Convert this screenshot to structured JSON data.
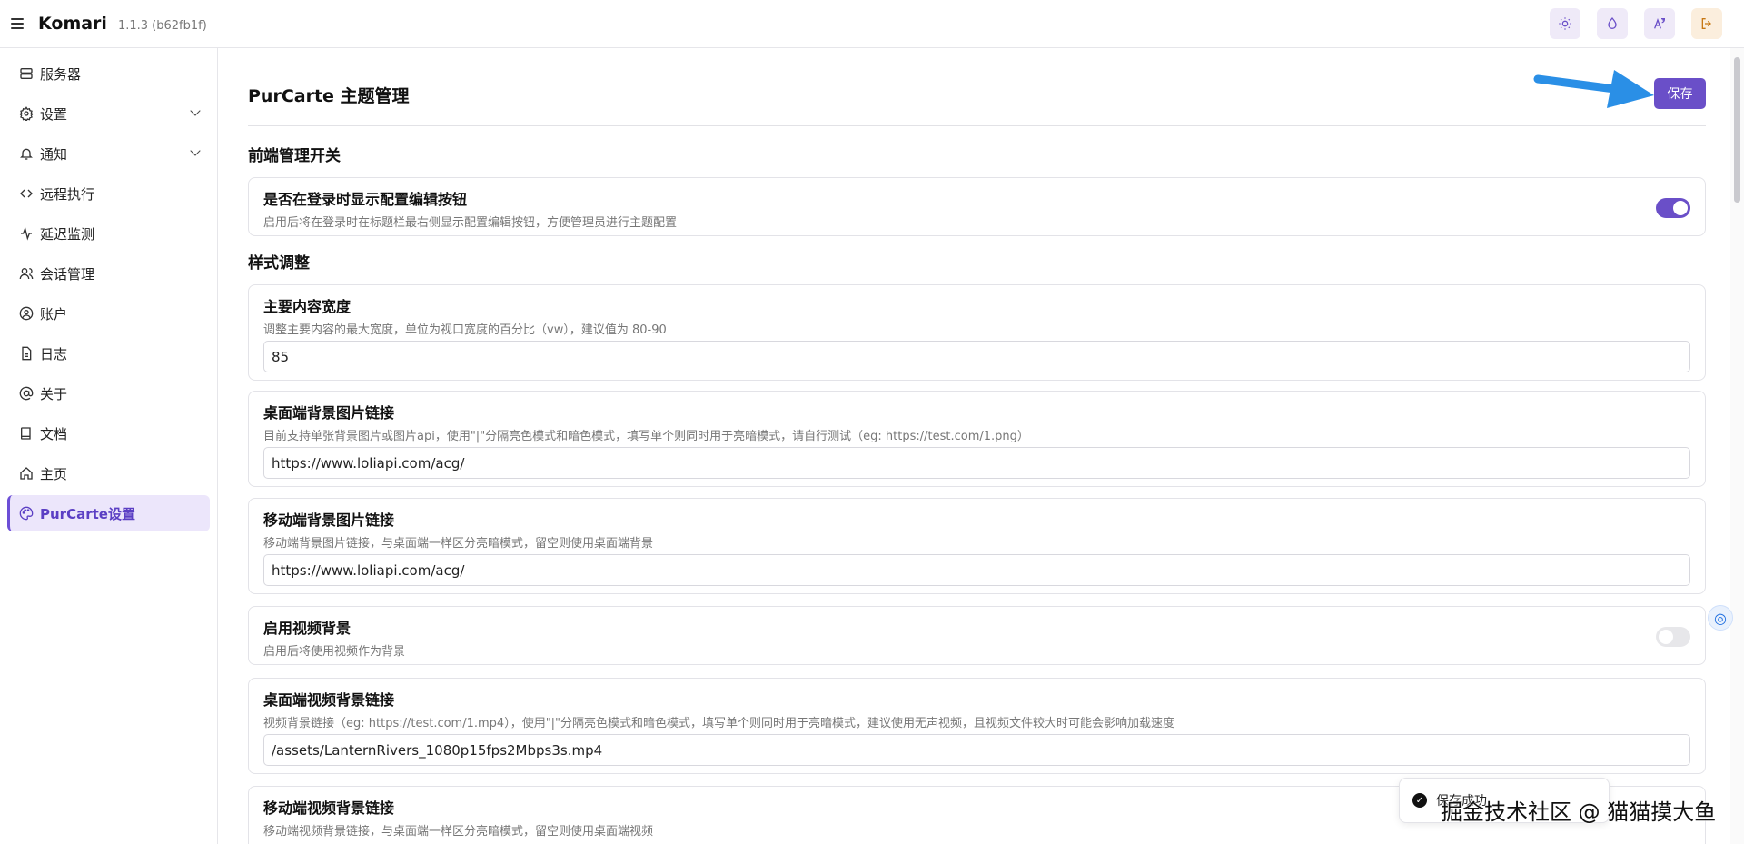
{
  "header": {
    "brand": "Komari",
    "version": "1.1.3 (b62fb1f)"
  },
  "sidebar": {
    "items": [
      {
        "label": "服务器",
        "icon": "server-icon"
      },
      {
        "label": "设置",
        "icon": "settings-icon"
      },
      {
        "label": "通知",
        "icon": "bell-icon"
      },
      {
        "label": "远程执行",
        "icon": "code-icon"
      },
      {
        "label": "延迟监测",
        "icon": "activity-icon"
      },
      {
        "label": "会话管理",
        "icon": "users-icon"
      },
      {
        "label": "账户",
        "icon": "user-circle-icon"
      },
      {
        "label": "日志",
        "icon": "file-icon"
      },
      {
        "label": "关于",
        "icon": "at-icon"
      },
      {
        "label": "文档",
        "icon": "book-icon"
      },
      {
        "label": "主页",
        "icon": "home-icon"
      },
      {
        "label": "PurCarte设置",
        "icon": "palette-icon"
      }
    ]
  },
  "page": {
    "title": "PurCarte 主题管理",
    "save_label": "保存"
  },
  "sections": {
    "frontend": "前端管理开关",
    "style": "样式调整"
  },
  "settings": {
    "show_edit_button": {
      "title": "是否在登录时显示配置编辑按钮",
      "desc": "启用后将在登录时在标题栏最右侧显示配置编辑按钮，方便管理员进行主题配置",
      "enabled": true
    },
    "content_width": {
      "title": "主要内容宽度",
      "desc": "调整主要内容的最大宽度，单位为视口宽度的百分比（vw），建议值为 80-90",
      "value": "85"
    },
    "desktop_bg": {
      "title": "桌面端背景图片链接",
      "desc": "目前支持单张背景图片或图片api，使用\"|\"分隔亮色模式和暗色模式，填写单个则同时用于亮暗模式，请自行测试（eg: https://test.com/1.png）",
      "value": "https://www.loliapi.com/acg/"
    },
    "mobile_bg": {
      "title": "移动端背景图片链接",
      "desc": "移动端背景图片链接，与桌面端一样区分亮暗模式，留空则使用桌面端背景",
      "value": "https://www.loliapi.com/acg/"
    },
    "video_bg": {
      "title": "启用视频背景",
      "desc": "启用后将使用视频作为背景",
      "enabled": false
    },
    "desktop_video": {
      "title": "桌面端视频背景链接",
      "desc": "视频背景链接（eg: https://test.com/1.mp4），使用\"|\"分隔亮色模式和暗色模式，填写单个则同时用于亮暗模式，建议使用无声视频，且视频文件较大时可能会影响加载速度",
      "value": "/assets/LanternRivers_1080p15fps2Mbps3s.mp4"
    },
    "mobile_video": {
      "title": "移动端视频背景链接",
      "desc": "移动端视频背景链接，与桌面端一样区分亮暗模式，留空则使用桌面端视频"
    }
  },
  "toast": {
    "text": "保存成功"
  },
  "watermark": "掘金技术社区 @ 猫猫摸大鱼",
  "colors": {
    "accent": "#6a4fc8",
    "active_bg": "#ece6fb"
  }
}
